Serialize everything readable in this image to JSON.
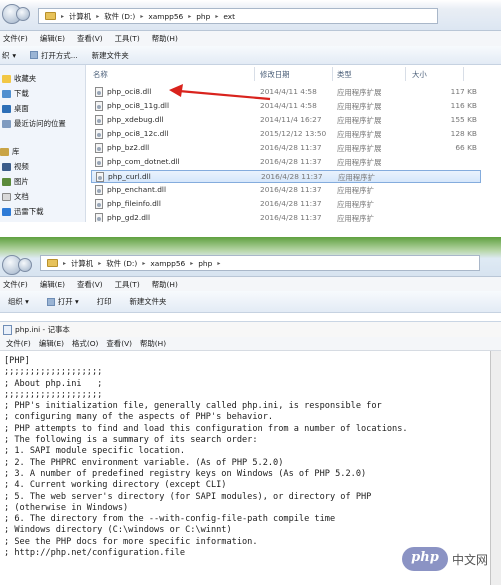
{
  "top": {
    "breadcrumb": [
      "计算机",
      "软件 (D:)",
      "xampp56",
      "php",
      "ext"
    ],
    "menu": [
      "文件(F)",
      "编辑(E)",
      "查看(V)",
      "工具(T)",
      "帮助(H)"
    ],
    "toolbar": {
      "organize": "织",
      "open_with": "打开方式...",
      "new_folder": "新建文件夹"
    },
    "sidebar": [
      "收藏夹",
      "下载",
      "桌面",
      "最近访问的位置",
      "库",
      "视频",
      "图片",
      "文档",
      "迅雷下载"
    ],
    "columns": {
      "name": "名称",
      "modified": "修改日期",
      "type": "类型",
      "size": "大小"
    },
    "files": [
      {
        "name": "php_oci8.dll",
        "date": "2014/4/11 4:58",
        "type": "应用程序扩展",
        "size": "117 KB"
      },
      {
        "name": "php_oci8_11g.dll",
        "date": "2014/4/11 4:58",
        "type": "应用程序扩展",
        "size": "116 KB"
      },
      {
        "name": "php_xdebug.dll",
        "date": "2014/11/4 16:27",
        "type": "应用程序扩展",
        "size": "155 KB"
      },
      {
        "name": "php_oci8_12c.dll",
        "date": "2015/12/12 13:50",
        "type": "应用程序扩展",
        "size": "128 KB"
      },
      {
        "name": "php_bz2.dll",
        "date": "2016/4/28 11:37",
        "type": "应用程序扩展",
        "size": "66 KB"
      },
      {
        "name": "php_com_dotnet.dll",
        "date": "2016/4/28 11:37",
        "type": "应用程序扩展",
        "size": ""
      },
      {
        "name": "php_curl.dll",
        "date": "2016/4/28 11:37",
        "type": "应用程序扩",
        "size": ""
      },
      {
        "name": "php_enchant.dll",
        "date": "2016/4/28 11:37",
        "type": "应用程序扩",
        "size": ""
      },
      {
        "name": "php_fileinfo.dll",
        "date": "2016/4/28 11:37",
        "type": "应用程序扩",
        "size": ""
      },
      {
        "name": "php_gd2.dll",
        "date": "2016/4/28 11:37",
        "type": "应用程序扩",
        "size": ""
      }
    ],
    "selected_file": "php_curl.dll"
  },
  "bottom": {
    "breadcrumb": [
      "计算机",
      "软件 (D:)",
      "xampp56",
      "php"
    ],
    "menu": [
      "文件(F)",
      "编辑(E)",
      "查看(V)",
      "工具(T)",
      "帮助(H)"
    ],
    "toolbar": {
      "organize": "组织 ▾",
      "open": "打开 ▾",
      "print": "打印",
      "new_folder": "新建文件夹"
    },
    "notepad": {
      "title": "php.ini - 记事本",
      "menu": [
        "文件(F)",
        "编辑(E)",
        "格式(O)",
        "查看(V)",
        "帮助(H)"
      ],
      "lines": [
        "[PHP]",
        "",
        ";;;;;;;;;;;;;;;;;;;",
        "; About php.ini   ;",
        ";;;;;;;;;;;;;;;;;;;",
        "; PHP's initialization file, generally called php.ini, is responsible for",
        "; configuring many of the aspects of PHP's behavior.",
        "",
        "; PHP attempts to find and load this configuration from a number of locations.",
        "; The following is a summary of its search order:",
        "; 1. SAPI module specific location.",
        "; 2. The PHPRC environment variable. (As of PHP 5.2.0)",
        "; 3. A number of predefined registry keys on Windows (As of PHP 5.2.0)",
        "; 4. Current working directory (except CLI)",
        "; 5. The web server's directory (for SAPI modules), or directory of PHP",
        "; (otherwise in Windows)",
        "; 6. The directory from the --with-config-file-path compile time",
        "; Windows directory (C:\\windows or C:\\winnt)",
        "; See the PHP docs for more specific information.",
        "; http://php.net/configuration.file"
      ]
    }
  },
  "watermark": {
    "logo": "php",
    "text": "中文网"
  },
  "colors": {
    "arrow": "#d9231d",
    "selection": "#d6e7fb",
    "watermark": "#8b93c4"
  }
}
